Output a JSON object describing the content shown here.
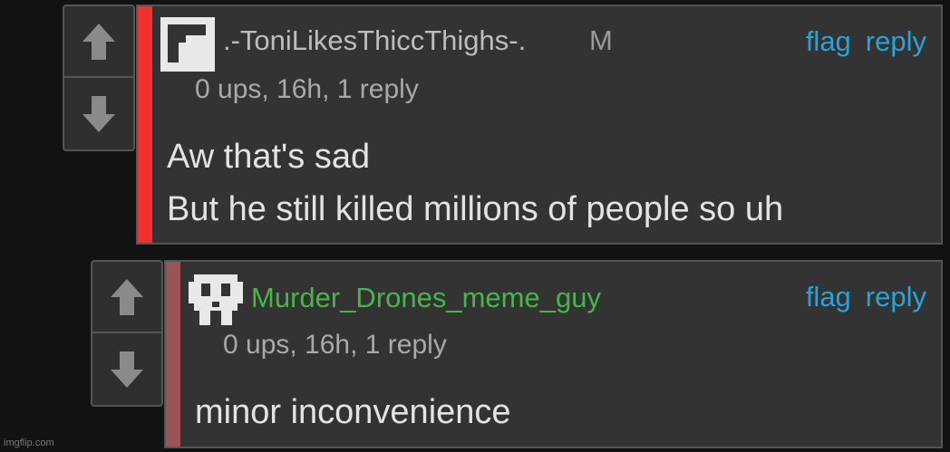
{
  "comments": [
    {
      "username": ".-ToniLikesThiccThighs-.",
      "badge": "M",
      "meta": "0 ups, 16h, 1 reply",
      "actions": {
        "flag": "flag",
        "reply": "reply"
      },
      "lines": [
        "Aw that's sad",
        "But he still killed millions of people so uh"
      ],
      "username_color": "#bdbdbd",
      "stripe_color": "#f2302f"
    },
    {
      "username": "Murder_Drones_meme_guy",
      "meta": "0 ups, 16h, 1 reply",
      "actions": {
        "flag": "flag",
        "reply": "reply"
      },
      "lines": [
        "minor inconvenience"
      ],
      "username_color": "#47b649",
      "stripe_color": "#9b5353"
    }
  ],
  "watermark": "imgflip.com",
  "colors": {
    "link": "#2aa3d8",
    "background": "#121212",
    "card": "#333333"
  }
}
